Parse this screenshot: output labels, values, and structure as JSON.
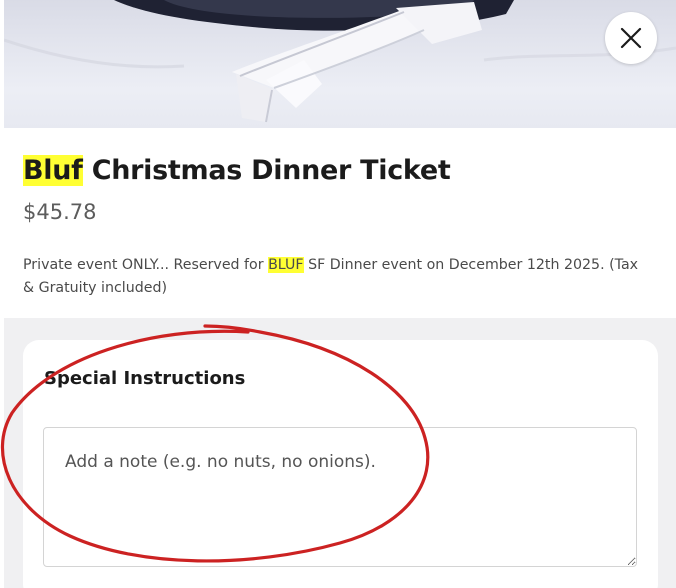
{
  "item": {
    "title_highlight": "Bluf",
    "title_rest": " Christmas Dinner Ticket",
    "price": "$45.78",
    "description": {
      "part1": "Private event ONLY... Reserved for ",
      "highlight": "BLUF",
      "part2": " SF Dinner event on December 12th 2025. (Tax & Gratuity included)"
    }
  },
  "close_button": {
    "icon": "close-icon"
  },
  "special_instructions": {
    "heading": "Special Instructions",
    "placeholder": "Add a note (e.g. no nuts, no onions).",
    "value": ""
  },
  "colors": {
    "highlight": "#ffff33",
    "annotation": "#cc2222",
    "grey_background": "#f0f0f2"
  }
}
